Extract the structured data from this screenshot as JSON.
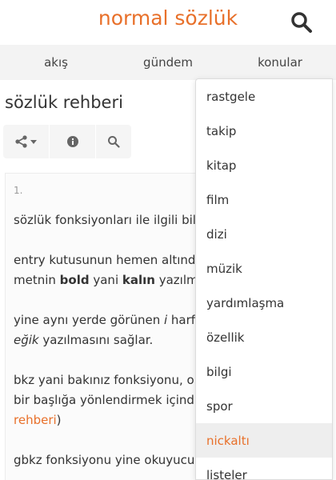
{
  "header": {
    "brand": "normal sözlük"
  },
  "nav": {
    "items": [
      "akış",
      "gündem",
      "konular"
    ]
  },
  "page": {
    "title": "sözlük rehberi"
  },
  "toolbar": {
    "icons": [
      "share-icon",
      "info-icon",
      "search-icon"
    ]
  },
  "entry": {
    "number": "1.",
    "p1": "sözlük fonksiyonları ile ilgili bil",
    "p2_line1": "entry kutusunun hemen altınd",
    "p2_line2_a": "metnin ",
    "p2_bold1": "bold",
    "p2_line2_b": " yani ",
    "p2_bold2": "kalın",
    "p2_line2_c": " yazılma",
    "p3_line1_a": "yine aynı yerde görünen ",
    "p3_italic1": "i",
    "p3_line1_b": " harfi",
    "p3_italic2": "eğik",
    "p3_line2_b": " yazılmasını sağlar.",
    "p4_line1": "bkz yani bakınız fonksiyonu, ol",
    "p4_line2": "bir başlığa yönlendirmek içind",
    "p4_link": "rehberi",
    "p4_line3_b": ")",
    "p5_line1": "gbkz fonksiyonu yine okuyucu"
  },
  "dropdown": {
    "items": [
      "rastgele",
      "takip",
      "kitap",
      "film",
      "dizi",
      "müzik",
      "yardımlaşma",
      "özellik",
      "bilgi",
      "spor",
      "nickaltı",
      "listeler"
    ],
    "active_index": 10
  },
  "colors": {
    "accent": "#e8702a",
    "nav_bg": "#f3f3f3"
  }
}
